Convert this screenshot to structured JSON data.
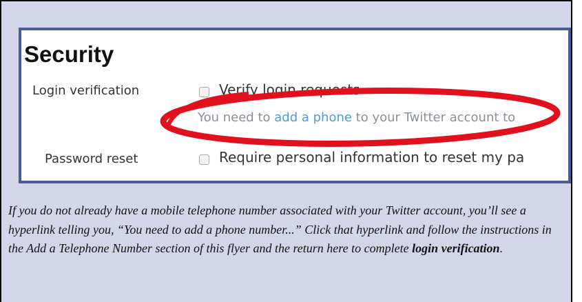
{
  "screenshot": {
    "title": "Security",
    "login_verification": {
      "label": "Login verification",
      "checkbox_label": "Verify login requests",
      "hint_before": "You need to ",
      "hint_link": "add a phone",
      "hint_after": " to your Twitter account to"
    },
    "password_reset": {
      "label": "Password reset",
      "checkbox_label": "Require personal information to reset my pa"
    },
    "annotation_color": "#e0101c",
    "frame_color": "#4a5b9a"
  },
  "caption": {
    "text": "If you do not already have a mobile telephone number associated with your Twitter account, you’ll see a hyperlink telling you, “You need to add a phone number...” Click that hyperlink and follow the instructions in the Add a Telephone Number section of this flyer and the return here to complete ",
    "bold": "login verification",
    "end": "."
  },
  "colors": {
    "panel_bg": "#d3d6e8",
    "link": "#4f9bd6"
  }
}
